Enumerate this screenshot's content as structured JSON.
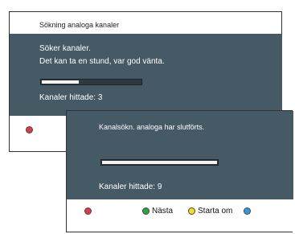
{
  "back_dialog": {
    "title": "Sökning analoga kanaler",
    "line1": "Söker kanaler.",
    "line2": "Det kan ta en stund, var god vänta.",
    "progress": 0.38,
    "channels_found": "Kanaler hittade: 3",
    "keys": [
      {
        "color": "#e03a4a"
      }
    ]
  },
  "front_dialog": {
    "message": "Kanalsökn. analoga har slutförts.",
    "progress": 1.0,
    "channels_found": "Kanaler hittade: 9",
    "keys": [
      {
        "color": "#e03a4a",
        "label": ""
      },
      {
        "color": "#23a846",
        "label": "Nästa"
      },
      {
        "color": "#f3e11a",
        "label": "Starta om"
      },
      {
        "color": "#2d9cdb",
        "label": ""
      }
    ]
  }
}
